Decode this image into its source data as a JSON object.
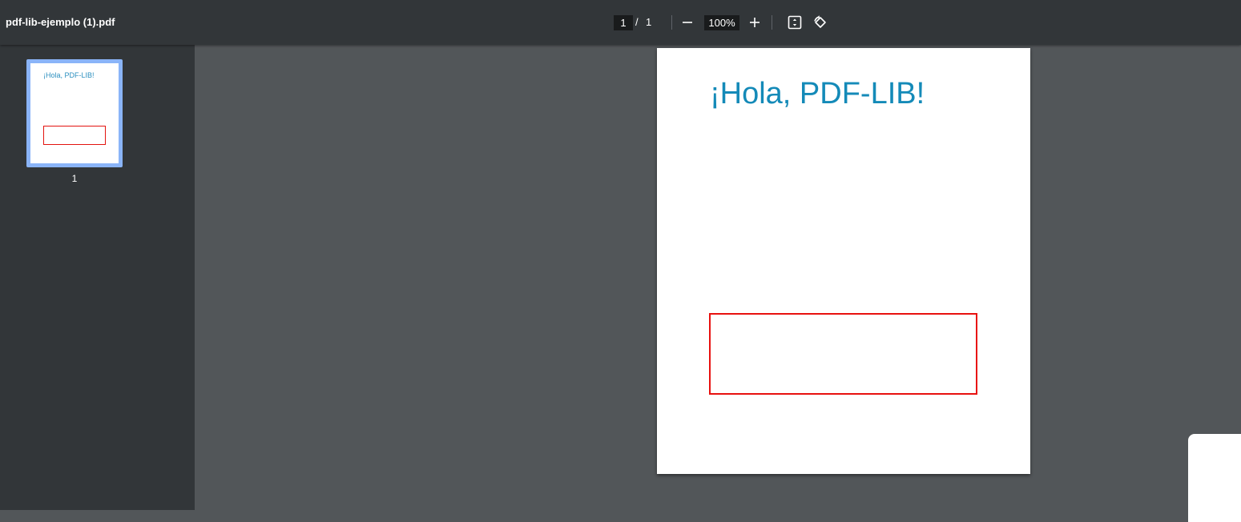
{
  "toolbar": {
    "document_title": "pdf-lib-ejemplo (1).pdf",
    "current_page": "1",
    "page_separator": "/",
    "total_pages": "1",
    "zoom_level": "100%",
    "icons": {
      "zoom_out": "minus-icon",
      "zoom_in": "plus-icon",
      "fit": "fit-to-page-icon",
      "rotate": "rotate-counterclockwise-icon"
    }
  },
  "sidebar": {
    "thumbnails": [
      {
        "page_label": "1",
        "preview_text": "¡Hola, PDF-LIB!"
      }
    ]
  },
  "page": {
    "heading": "¡Hola, PDF-LIB!"
  },
  "colors": {
    "toolbar_bg": "#323639",
    "viewer_bg": "#525659",
    "thumbnail_selected_border": "#8ab4f8",
    "heading_text": "#148ab8",
    "rectangle_border": "#e8110f"
  }
}
